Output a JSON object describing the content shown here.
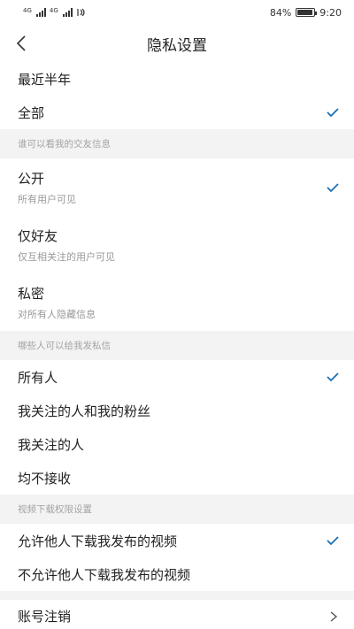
{
  "status_bar": {
    "carrier_tag_1": "4G",
    "carrier_tag_2": "4G",
    "battery_percent": "84%",
    "battery_level": 0.84,
    "time": "9:20"
  },
  "nav": {
    "title": "隐私设置"
  },
  "time_range": {
    "items": [
      {
        "label": "最近半年",
        "checked": false
      },
      {
        "label": "全部",
        "checked": true
      }
    ]
  },
  "friend_info": {
    "header": "谁可以看我的交友信息",
    "items": [
      {
        "label": "公开",
        "sub": "所有用户可见",
        "checked": true
      },
      {
        "label": "仅好友",
        "sub": "仅互相关注的用户可见",
        "checked": false
      },
      {
        "label": "私密",
        "sub": "对所有人隐藏信息",
        "checked": false
      }
    ]
  },
  "messages": {
    "header": "哪些人可以给我发私信",
    "items": [
      {
        "label": "所有人",
        "checked": true
      },
      {
        "label": "我关注的人和我的粉丝",
        "checked": false
      },
      {
        "label": "我关注的人",
        "checked": false
      },
      {
        "label": "均不接收",
        "checked": false
      }
    ]
  },
  "download": {
    "header": "视频下载权限设置",
    "items": [
      {
        "label": "允许他人下载我发布的视频",
        "checked": true
      },
      {
        "label": "不允许他人下载我发布的视频",
        "checked": false
      }
    ]
  },
  "account": {
    "cancel_label": "账号注销"
  },
  "colors": {
    "check": "#1a6fb5",
    "section_bg": "#f3f3f3",
    "section_text": "#a3a3a3"
  }
}
